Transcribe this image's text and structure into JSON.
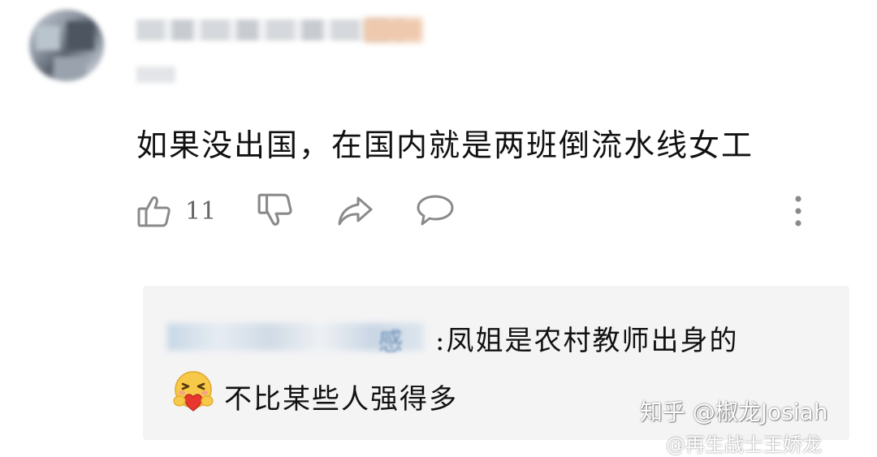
{
  "comment": {
    "text": "如果没出国，在国内就是两班倒流水线女工",
    "like_count": "11",
    "icons": {
      "like": "thumbs-up-icon",
      "dislike": "thumbs-down-icon",
      "share": "share-arrow-icon",
      "reply": "speech-bubble-icon",
      "more": "more-vertical-icon"
    }
  },
  "reply": {
    "name_tail": "感",
    "line1": ":凤姐是农村教师出身的",
    "emoji": "hug-heart-emoji",
    "line2": "不比某些人强得多"
  },
  "watermark": {
    "primary": "知乎 @椒龙Josiah",
    "secondary": "@再生战士王娇龙"
  },
  "colors": {
    "accent_link": "#6b8fb8",
    "reply_bg": "#f4f4f5",
    "icon_gray": "#8a8a8a"
  }
}
